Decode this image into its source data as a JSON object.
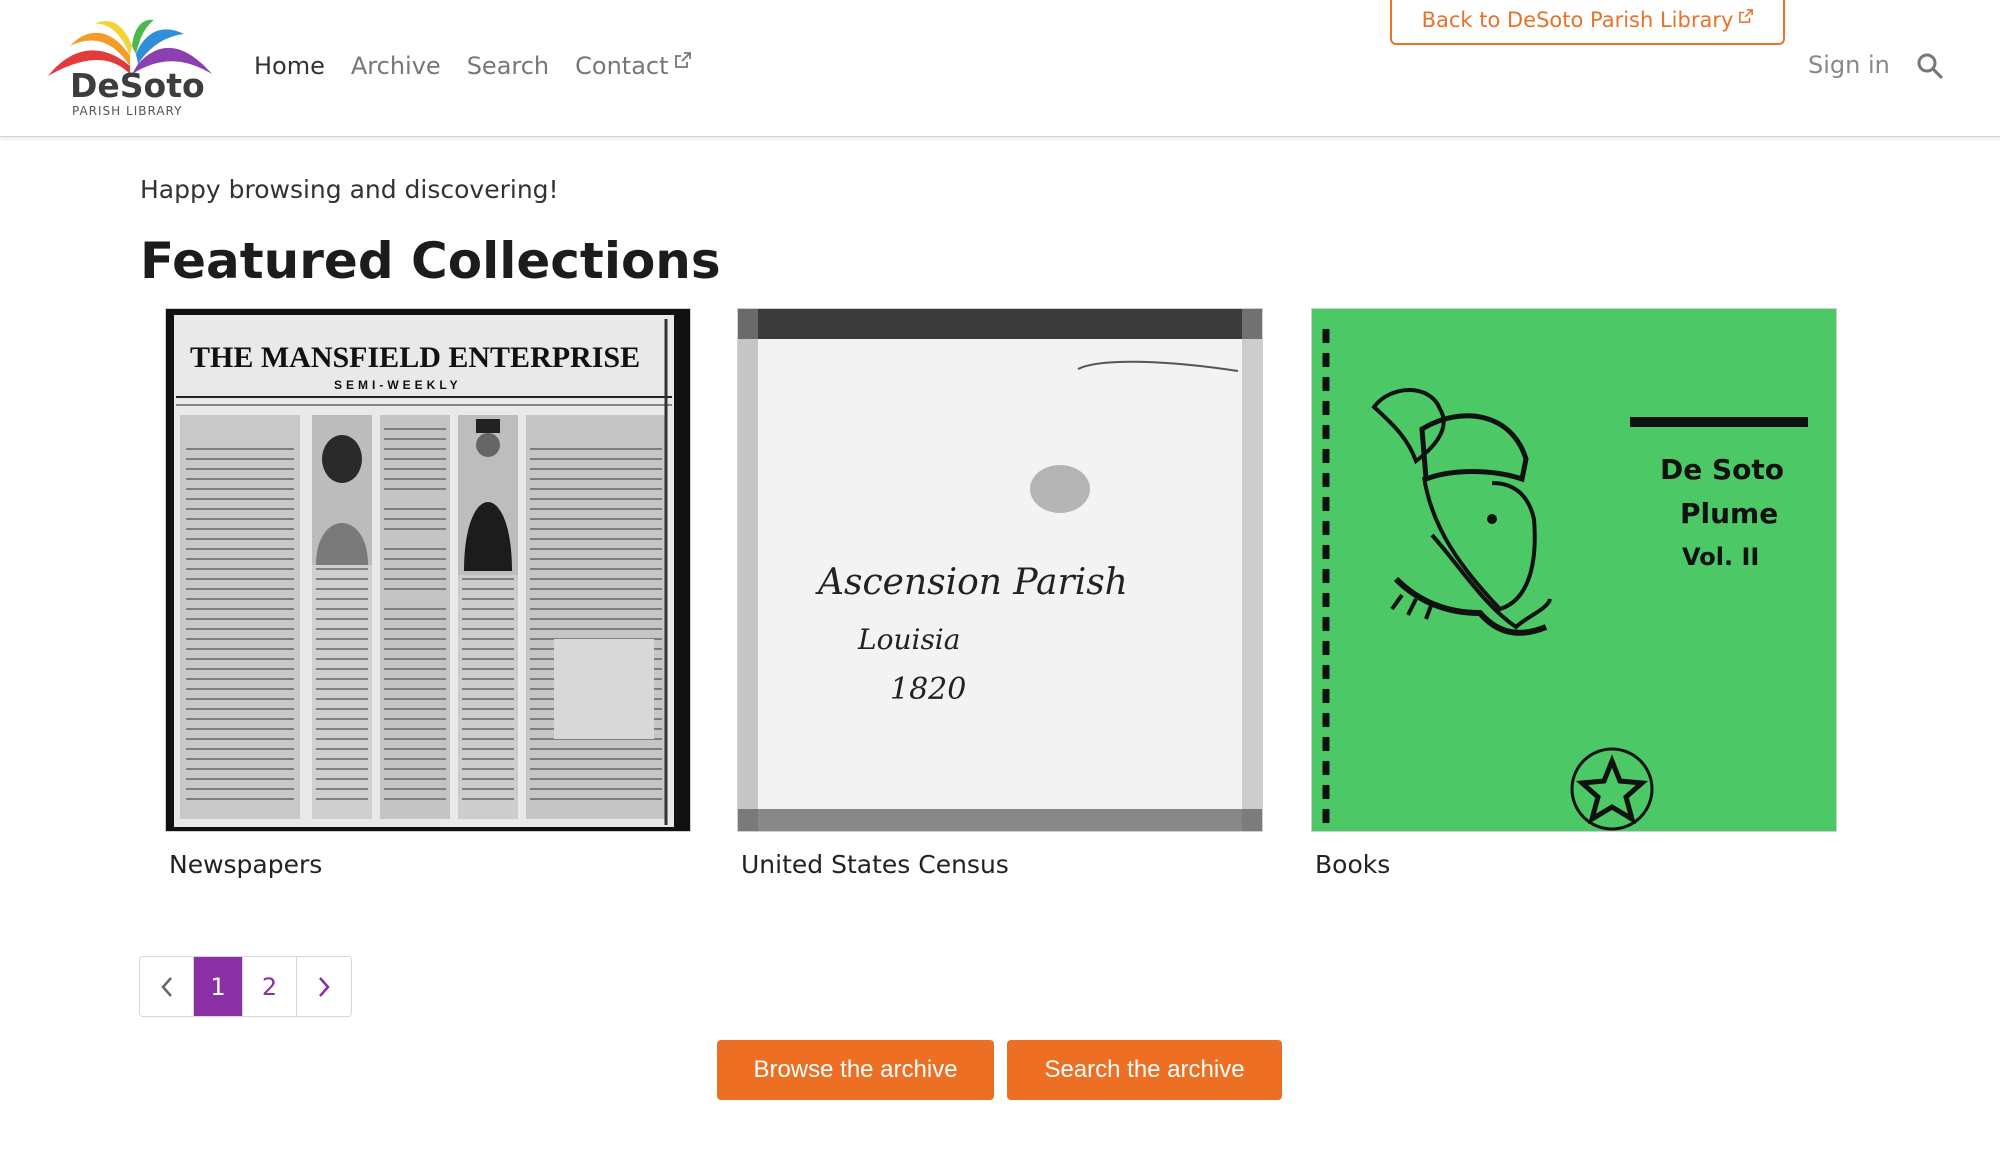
{
  "header": {
    "logo_text": "DeSoto",
    "logo_sub": "PARISH LIBRARY",
    "nav": [
      {
        "label": "Home",
        "active": true
      },
      {
        "label": "Archive",
        "active": false
      },
      {
        "label": "Search",
        "active": false
      },
      {
        "label": "Contact",
        "active": false,
        "external": true
      }
    ],
    "back_link": "Back to DeSoto Parish Library",
    "signin": "Sign in",
    "search_icon": "search-icon"
  },
  "main": {
    "intro": "Happy browsing and discovering!",
    "section_title": "Featured Collections",
    "collections": [
      {
        "caption": "Newspapers",
        "image_title": "THE MANSFIELD ENTERPRISE",
        "image_subtitle": "SEMI-WEEKLY"
      },
      {
        "caption": "United States Census",
        "image_lines": [
          "Ascension Parish",
          "Louisia",
          "1820"
        ]
      },
      {
        "caption": "Books",
        "image_lines": [
          "De Soto",
          "Plume",
          "Vol. II"
        ]
      }
    ],
    "pagination": {
      "pages": [
        "1",
        "2"
      ],
      "current": "1",
      "prev_icon": "chevron-left-icon",
      "next_icon": "chevron-right-icon"
    },
    "actions": {
      "browse": "Browse the archive",
      "search": "Search the archive"
    }
  },
  "colors": {
    "accent": "#ec6f23",
    "pager_active": "#8b2fa5",
    "book_green": "#4cc866"
  }
}
